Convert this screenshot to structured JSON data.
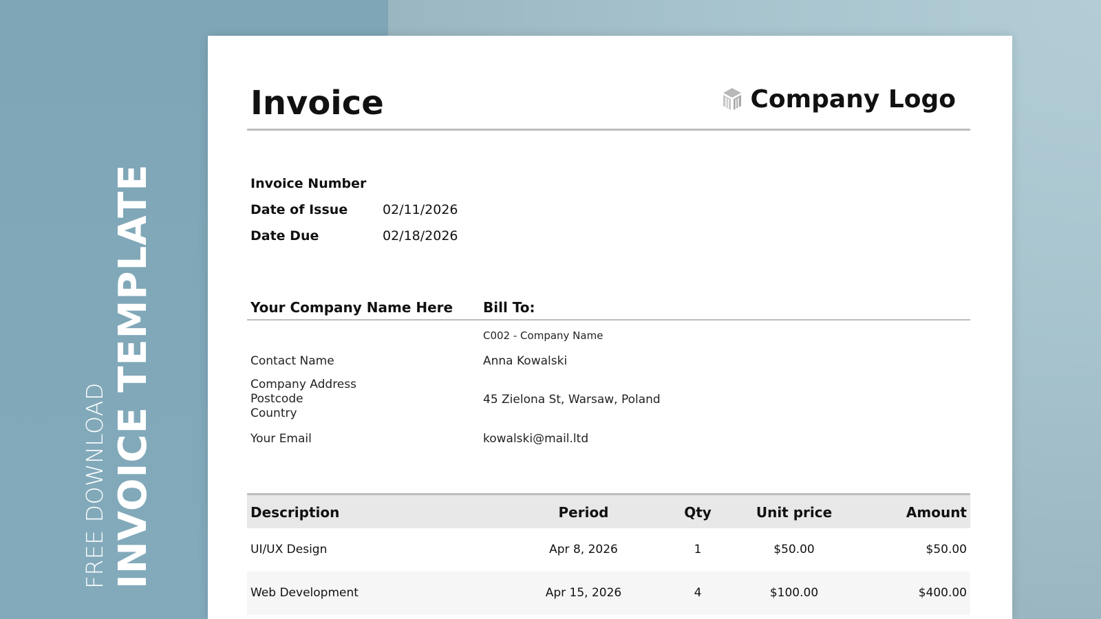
{
  "side": {
    "line1": "FREE DOWNLOAD",
    "line2": "INVOICE TEMPLATE"
  },
  "invoice": {
    "title": "Invoice",
    "logo_text": "Company Logo",
    "logo_icon": "cube-logo-icon"
  },
  "meta": {
    "invoice_number_label": "Invoice Number",
    "invoice_number_value": "",
    "date_issue_label": "Date of Issue",
    "date_issue_value": "02/11/2026",
    "date_due_label": "Date Due",
    "date_due_value": "02/18/2026"
  },
  "from": {
    "heading": "Your Company Name Here",
    "contact": "Contact Name",
    "address_line1": "Company Address",
    "address_line2": "Postcode",
    "address_line3": "Country",
    "email": "Your Email"
  },
  "bill_to": {
    "heading": "Bill To:",
    "company": "C002 - Company Name",
    "contact": "Anna Kowalski",
    "address": "45 Zielona St, Warsaw, Poland",
    "email": "kowalski@mail.ltd"
  },
  "table": {
    "headers": {
      "description": "Description",
      "period": "Period",
      "qty": "Qty",
      "unit_price": "Unit price",
      "amount": "Amount"
    },
    "rows": [
      {
        "description": "UI/UX Design",
        "period": "Apr 8, 2026",
        "qty": "1",
        "unit_price": "$50.00",
        "amount": "$50.00"
      },
      {
        "description": "Web Development",
        "period": "Apr 15, 2026",
        "qty": "4",
        "unit_price": "$100.00",
        "amount": "$400.00"
      }
    ]
  },
  "colors": {
    "background_left": "#7ea6b6",
    "background_right": "#a6c3cd",
    "paper": "#ffffff",
    "rule": "#bdbdbd",
    "table_header_bg": "#e8e8e8"
  }
}
